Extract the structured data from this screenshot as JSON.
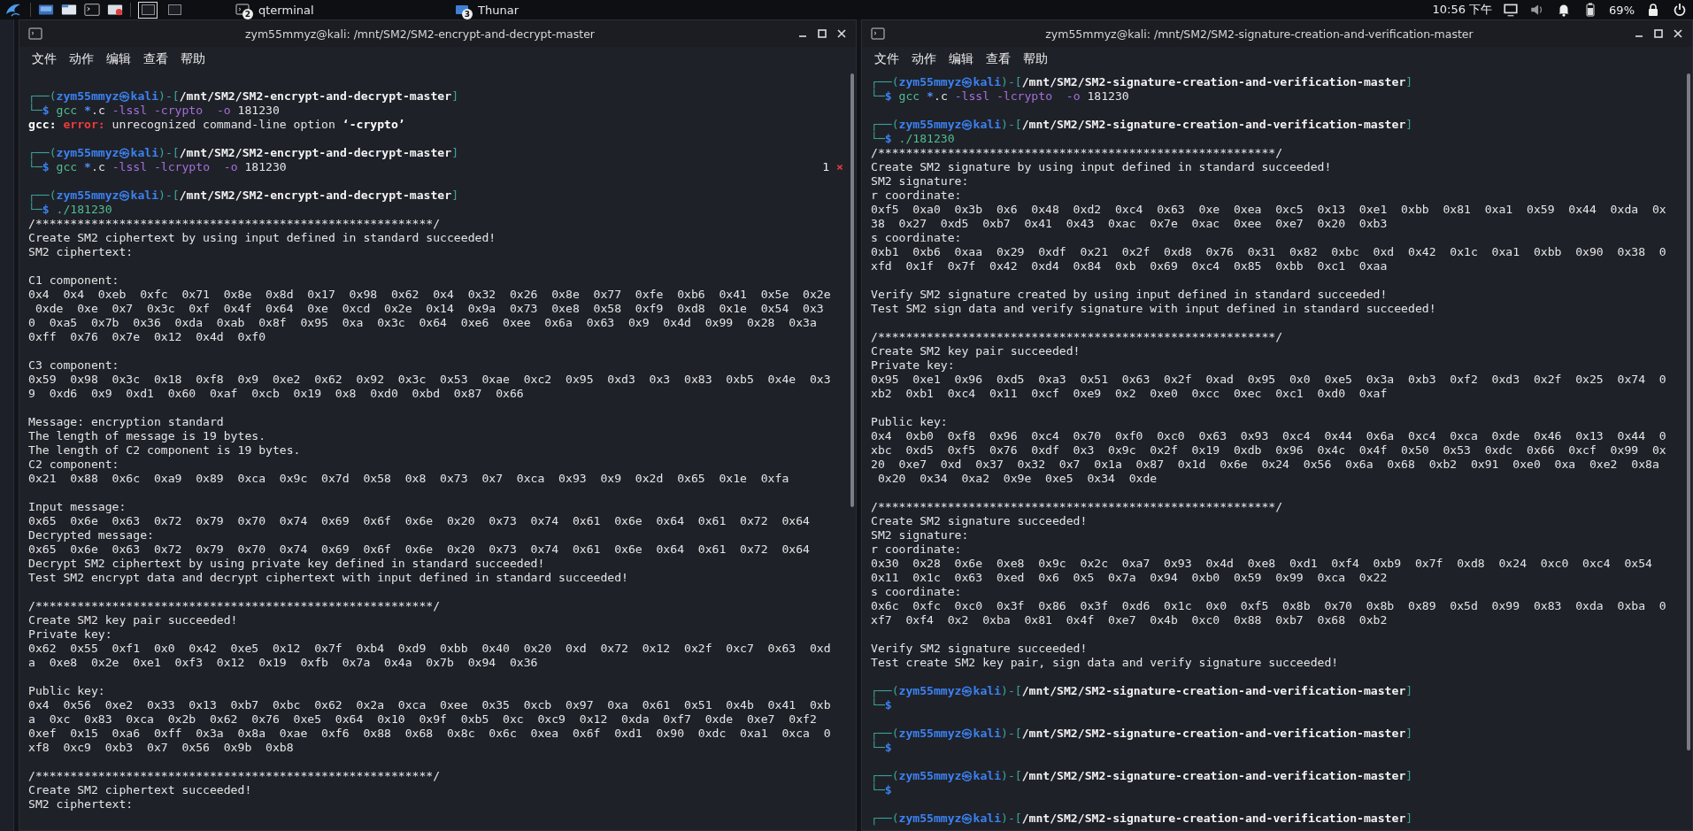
{
  "panel": {
    "workspaces": [
      {
        "selected": true
      },
      {
        "selected": false
      }
    ],
    "tasks": [
      {
        "kind": "terminal",
        "label": "qterminal",
        "badge": "2"
      },
      {
        "kind": "folder",
        "label": "Thunar",
        "badge": "3"
      }
    ],
    "clock": "10:56 下午",
    "battery": "69%"
  },
  "terminals": [
    {
      "title": "zym55mmyz@kali: /mnt/SM2/SM2-encrypt-and-decrypt-master",
      "menu": [
        "文件",
        "动作",
        "编辑",
        "查看",
        "帮助"
      ],
      "lines": [
        {
          "kind": "blank"
        },
        {
          "kind": "prompt",
          "open": "┌──(",
          "user": "zym55mmyz㉿kali",
          "mid": ")-[",
          "path": "/mnt/SM2/SM2-encrypt-and-decrypt-master",
          "close": "]"
        },
        {
          "kind": "command",
          "lead": "└─",
          "dollar": "$ ",
          "program": "gcc ",
          "glob": "*",
          "rest": ".c ",
          "options": "-lssl -crypto  -o ",
          "arg": "181230"
        },
        {
          "kind": "error",
          "source": "gcc: ",
          "severity": "error:",
          "message": " unrecognized command-line option ",
          "option": "‘-crypto’"
        },
        {
          "kind": "blank"
        },
        {
          "kind": "prompt",
          "open": "┌──(",
          "user": "zym55mmyz㉿kali",
          "mid": ")-[",
          "path": "/mnt/SM2/SM2-encrypt-and-decrypt-master",
          "close": "]"
        },
        {
          "kind": "command",
          "lead": "└─",
          "dollar": "$ ",
          "program": "gcc ",
          "glob": "*",
          "rest": ".c ",
          "options": "-lssl -lcrypto  -o ",
          "arg": "181230",
          "status": {
            "code": "1",
            "mark": "×"
          }
        },
        {
          "kind": "blank"
        },
        {
          "kind": "prompt",
          "open": "┌──(",
          "user": "zym55mmyz㉿kali",
          "mid": ")-[",
          "path": "/mnt/SM2/SM2-encrypt-and-decrypt-master",
          "close": "]"
        },
        {
          "kind": "command",
          "lead": "└─",
          "dollar": "$ ",
          "program": "./181230"
        },
        {
          "kind": "text",
          "text": "/*********************************************************/"
        },
        {
          "kind": "text",
          "text": "Create SM2 ciphertext by using input defined in standard succeeded!"
        },
        {
          "kind": "text",
          "text": "SM2 ciphertext:"
        },
        {
          "kind": "blank"
        },
        {
          "kind": "text",
          "text": "C1 component:"
        },
        {
          "kind": "text",
          "text": "0x4  0x4  0xeb  0xfc  0x71  0x8e  0x8d  0x17  0x98  0x62  0x4  0x32  0x26  0x8e  0x77  0xfe  0xb6  0x41  0x5e  0x2e"
        },
        {
          "kind": "text",
          "text": " 0xde  0xe  0x7  0x3c  0xf  0x4f  0x64  0xe  0xcd  0x2e  0x14  0x9a  0x73  0xe8  0x58  0xf9  0xd8  0x1e  0x54  0x3"
        },
        {
          "kind": "text",
          "text": "0  0xa5  0x7b  0x36  0xda  0xab  0x8f  0x95  0xa  0x3c  0x64  0xe6  0xee  0x6a  0x63  0x9  0x4d  0x99  0x28  0x3a"
        },
        {
          "kind": "text",
          "text": "0xff  0x76  0x7e  0x12  0x4d  0xf0"
        },
        {
          "kind": "blank"
        },
        {
          "kind": "text",
          "text": "C3 component:"
        },
        {
          "kind": "text",
          "text": "0x59  0x98  0x3c  0x18  0xf8  0x9  0xe2  0x62  0x92  0x3c  0x53  0xae  0xc2  0x95  0xd3  0x3  0x83  0xb5  0x4e  0x3"
        },
        {
          "kind": "text",
          "text": "9  0xd6  0x9  0xd1  0x60  0xaf  0xcb  0x19  0x8  0xd0  0xbd  0x87  0x66"
        },
        {
          "kind": "blank"
        },
        {
          "kind": "text",
          "text": "Message: encryption standard"
        },
        {
          "kind": "text",
          "text": "The length of message is 19 bytes."
        },
        {
          "kind": "text",
          "text": "The length of C2 component is 19 bytes."
        },
        {
          "kind": "text",
          "text": "C2 component:"
        },
        {
          "kind": "text",
          "text": "0x21  0x88  0x6c  0xa9  0x89  0xca  0x9c  0x7d  0x58  0x8  0x73  0x7  0xca  0x93  0x9  0x2d  0x65  0x1e  0xfa"
        },
        {
          "kind": "blank"
        },
        {
          "kind": "text",
          "text": "Input message:"
        },
        {
          "kind": "text",
          "text": "0x65  0x6e  0x63  0x72  0x79  0x70  0x74  0x69  0x6f  0x6e  0x20  0x73  0x74  0x61  0x6e  0x64  0x61  0x72  0x64"
        },
        {
          "kind": "text",
          "text": "Decrypted message:"
        },
        {
          "kind": "text",
          "text": "0x65  0x6e  0x63  0x72  0x79  0x70  0x74  0x69  0x6f  0x6e  0x20  0x73  0x74  0x61  0x6e  0x64  0x61  0x72  0x64"
        },
        {
          "kind": "text",
          "text": "Decrypt SM2 ciphertext by using private key defined in standard succeeded!"
        },
        {
          "kind": "text",
          "text": "Test SM2 encrypt data and decrypt ciphertext with input defined in standard succeeded!"
        },
        {
          "kind": "blank"
        },
        {
          "kind": "text",
          "text": "/*********************************************************/"
        },
        {
          "kind": "text",
          "text": "Create SM2 key pair succeeded!"
        },
        {
          "kind": "text",
          "text": "Private key:"
        },
        {
          "kind": "text",
          "text": "0x62  0x55  0xf1  0x0  0x42  0xe5  0x12  0x7f  0xb4  0xd9  0xbb  0x40  0x20  0xd  0x72  0x12  0x2f  0xc7  0x63  0xd"
        },
        {
          "kind": "text",
          "text": "a  0xe8  0x2e  0xe1  0xf3  0x12  0x19  0xfb  0x7a  0x4a  0x7b  0x94  0x36"
        },
        {
          "kind": "blank"
        },
        {
          "kind": "text",
          "text": "Public key:"
        },
        {
          "kind": "text",
          "text": "0x4  0x56  0xe2  0x33  0x13  0xb7  0xbc  0x62  0x2a  0xca  0xee  0x35  0xcb  0x97  0xa  0x61  0x51  0x4b  0x41  0xb"
        },
        {
          "kind": "text",
          "text": "a  0xc  0x83  0xca  0x2b  0x62  0x76  0xe5  0x64  0x10  0x9f  0xb5  0xc  0xc9  0x12  0xda  0xf7  0xde  0xe7  0xf2"
        },
        {
          "kind": "text",
          "text": "0xef  0x15  0xa6  0xff  0x3a  0x8a  0xae  0xf6  0x88  0x68  0x8c  0x6c  0xea  0x6f  0xd1  0x90  0xdc  0xa1  0xca  0"
        },
        {
          "kind": "text",
          "text": "xf8  0xc9  0xb3  0x7  0x56  0x9b  0xb8"
        },
        {
          "kind": "blank"
        },
        {
          "kind": "text",
          "text": "/*********************************************************/"
        },
        {
          "kind": "text",
          "text": "Create SM2 ciphertext succeeded!"
        },
        {
          "kind": "text",
          "text": "SM2 ciphertext:"
        }
      ]
    },
    {
      "title": "zym55mmyz@kali: /mnt/SM2/SM2-signature-creation-and-verification-master",
      "menu": [
        "文件",
        "动作",
        "编辑",
        "查看",
        "帮助"
      ],
      "lines": [
        {
          "kind": "prompt",
          "open": "┌──(",
          "user": "zym55mmyz㉿kali",
          "mid": ")-[",
          "path": "/mnt/SM2/SM2-signature-creation-and-verification-master",
          "close": "]"
        },
        {
          "kind": "command",
          "lead": "└─",
          "dollar": "$ ",
          "program": "gcc ",
          "glob": "*",
          "rest": ".c ",
          "options": "-lssl -lcrypto  -o ",
          "arg": "181230"
        },
        {
          "kind": "blank"
        },
        {
          "kind": "prompt",
          "open": "┌──(",
          "user": "zym55mmyz㉿kali",
          "mid": ")-[",
          "path": "/mnt/SM2/SM2-signature-creation-and-verification-master",
          "close": "]"
        },
        {
          "kind": "command",
          "lead": "└─",
          "dollar": "$ ",
          "program": "./181230"
        },
        {
          "kind": "text",
          "text": "/*********************************************************/"
        },
        {
          "kind": "text",
          "text": "Create SM2 signature by using input defined in standard succeeded!"
        },
        {
          "kind": "text",
          "text": "SM2 signature:"
        },
        {
          "kind": "text",
          "text": "r coordinate:"
        },
        {
          "kind": "text",
          "text": "0xf5  0xa0  0x3b  0x6  0x48  0xd2  0xc4  0x63  0xe  0xea  0xc5  0x13  0xe1  0xbb  0x81  0xa1  0x59  0x44  0xda  0x"
        },
        {
          "kind": "text",
          "text": "38  0x27  0xd5  0xb7  0x41  0x43  0xac  0x7e  0xac  0xee  0xe7  0x20  0xb3"
        },
        {
          "kind": "text",
          "text": "s coordinate:"
        },
        {
          "kind": "text",
          "text": "0xb1  0xb6  0xaa  0x29  0xdf  0x21  0x2f  0xd8  0x76  0x31  0x82  0xbc  0xd  0x42  0x1c  0xa1  0xbb  0x90  0x38  0"
        },
        {
          "kind": "text",
          "text": "xfd  0x1f  0x7f  0x42  0xd4  0x84  0xb  0x69  0xc4  0x85  0xbb  0xc1  0xaa"
        },
        {
          "kind": "blank"
        },
        {
          "kind": "text",
          "text": "Verify SM2 signature created by using input defined in standard succeeded!"
        },
        {
          "kind": "text",
          "text": "Test SM2 sign data and verify signature with input defined in standard succeeded!"
        },
        {
          "kind": "blank"
        },
        {
          "kind": "text",
          "text": "/*********************************************************/"
        },
        {
          "kind": "text",
          "text": "Create SM2 key pair succeeded!"
        },
        {
          "kind": "text",
          "text": "Private key:"
        },
        {
          "kind": "text",
          "text": "0x95  0xe1  0x96  0xd5  0xa3  0x51  0x63  0x2f  0xad  0x95  0x0  0xe5  0x3a  0xb3  0xf2  0xd3  0x2f  0x25  0x74  0"
        },
        {
          "kind": "text",
          "text": "xb2  0xb1  0xc4  0x11  0xcf  0xe9  0x2  0xe0  0xcc  0xec  0xc1  0xd0  0xaf"
        },
        {
          "kind": "blank"
        },
        {
          "kind": "text",
          "text": "Public key:"
        },
        {
          "kind": "text",
          "text": "0x4  0xb0  0xf8  0x96  0xc4  0x70  0xf0  0xc0  0x63  0x93  0xc4  0x44  0x6a  0xc4  0xca  0xde  0x46  0x13  0x44  0"
        },
        {
          "kind": "text",
          "text": "xbc  0xd5  0xf5  0x76  0xdf  0x3  0x9c  0x2f  0x19  0xdb  0x96  0x4c  0x4f  0x50  0x53  0xdc  0x66  0xcf  0x99  0x"
        },
        {
          "kind": "text",
          "text": "20  0xe7  0xd  0x37  0x32  0x7  0x1a  0x87  0x1d  0x6e  0x24  0x56  0x6a  0x68  0xb2  0x91  0xe0  0xa  0xe2  0x8a"
        },
        {
          "kind": "text",
          "text": " 0x20  0x34  0xa2  0x9e  0xe5  0x34  0xde"
        },
        {
          "kind": "blank"
        },
        {
          "kind": "text",
          "text": "/*********************************************************/"
        },
        {
          "kind": "text",
          "text": "Create SM2 signature succeeded!"
        },
        {
          "kind": "text",
          "text": "SM2 signature:"
        },
        {
          "kind": "text",
          "text": "r coordinate:"
        },
        {
          "kind": "text",
          "text": "0x30  0x28  0x6e  0xe8  0x9c  0x2c  0xa7  0x93  0x4d  0xe8  0xd1  0xf4  0xb9  0x7f  0xd8  0x24  0xc0  0xc4  0x54"
        },
        {
          "kind": "text",
          "text": "0x11  0x1c  0x63  0xed  0x6  0x5  0x7a  0x94  0xb0  0x59  0x99  0xca  0x22"
        },
        {
          "kind": "text",
          "text": "s coordinate:"
        },
        {
          "kind": "text",
          "text": "0x6c  0xfc  0xc0  0x3f  0x86  0x3f  0xd6  0x1c  0x0  0xf5  0x8b  0x70  0x8b  0x89  0x5d  0x99  0x83  0xda  0xba  0"
        },
        {
          "kind": "text",
          "text": "xf7  0xf4  0x2  0xba  0x81  0x4f  0xe7  0x4b  0xc0  0x88  0xb7  0x68  0xb2"
        },
        {
          "kind": "blank"
        },
        {
          "kind": "text",
          "text": "Verify SM2 signature succeeded!"
        },
        {
          "kind": "text",
          "text": "Test create SM2 key pair, sign data and verify signature succeeded!"
        },
        {
          "kind": "blank"
        },
        {
          "kind": "prompt",
          "open": "┌──(",
          "user": "zym55mmyz㉿kali",
          "mid": ")-[",
          "path": "/mnt/SM2/SM2-signature-creation-and-verification-master",
          "close": "]"
        },
        {
          "kind": "command",
          "lead": "└─",
          "dollar": "$"
        },
        {
          "kind": "blank"
        },
        {
          "kind": "prompt",
          "open": "┌──(",
          "user": "zym55mmyz㉿kali",
          "mid": ")-[",
          "path": "/mnt/SM2/SM2-signature-creation-and-verification-master",
          "close": "]"
        },
        {
          "kind": "command",
          "lead": "└─",
          "dollar": "$"
        },
        {
          "kind": "blank"
        },
        {
          "kind": "prompt",
          "open": "┌──(",
          "user": "zym55mmyz㉿kali",
          "mid": ")-[",
          "path": "/mnt/SM2/SM2-signature-creation-and-verification-master",
          "close": "]"
        },
        {
          "kind": "command",
          "lead": "└─",
          "dollar": "$"
        },
        {
          "kind": "blank"
        },
        {
          "kind": "prompt",
          "open": "┌──(",
          "user": "zym55mmyz㉿kali",
          "mid": ")-[",
          "path": "/mnt/SM2/SM2-signature-creation-and-verification-master",
          "close": "]"
        }
      ]
    }
  ]
}
